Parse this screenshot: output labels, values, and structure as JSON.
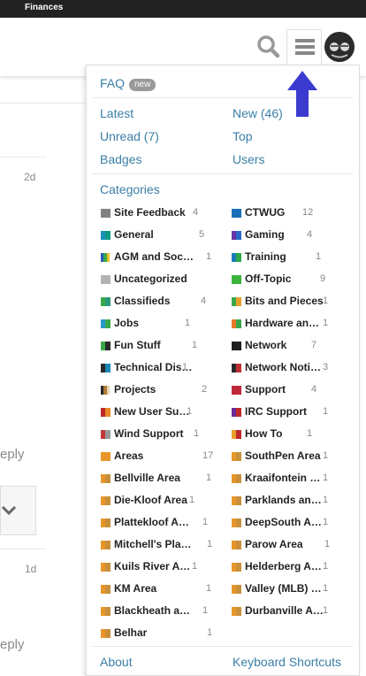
{
  "topbar": {
    "title": "Finances"
  },
  "background": {
    "time_1": "2d",
    "time_2": "1d",
    "reply_1": "eply",
    "reply_2": "eply"
  },
  "header": {
    "search_icon": "search-icon",
    "menu_icon": "hamburger-menu-icon",
    "avatar": "user-avatar"
  },
  "menu": {
    "faq": {
      "label": "FAQ",
      "badge": "new"
    },
    "links": [
      {
        "label": "Latest"
      },
      {
        "label": "New (46)"
      },
      {
        "label": "Unread (7)"
      },
      {
        "label": "Top"
      },
      {
        "label": "Badges"
      },
      {
        "label": "Users"
      }
    ],
    "categories_heading": "Categories",
    "categories": [
      {
        "name": "Site Feedback",
        "count": "4",
        "colors": [
          "#808080"
        ]
      },
      {
        "name": "CTWUG",
        "count": "12",
        "colors": [
          "#1a6fb8"
        ]
      },
      {
        "name": "General",
        "count": "5",
        "colors": [
          "#1a8fb8",
          "#0f9a84"
        ]
      },
      {
        "name": "Gaming",
        "count": "4",
        "colors": [
          "#6a34a8",
          "#2a6ac8"
        ]
      },
      {
        "name": "AGM and Soc…",
        "count": "1",
        "colors": [
          "#2a5ab8",
          "#3aa84a",
          "#e8c02a"
        ]
      },
      {
        "name": "Training",
        "count": "1",
        "colors": [
          "#1a7ab8",
          "#2aa84a"
        ]
      },
      {
        "name": "Uncategorized",
        "count": "",
        "colors": [
          "#b3b3b3"
        ]
      },
      {
        "name": "Off-Topic",
        "count": "9",
        "colors": [
          "#3cb43c"
        ]
      },
      {
        "name": "Classifieds",
        "count": "4",
        "colors": [
          "#3aa84a",
          "#2a9a7a"
        ]
      },
      {
        "name": "Bits and Pieces",
        "count": "1",
        "colors": [
          "#3aa84a",
          "#e8a02a"
        ]
      },
      {
        "name": "Jobs",
        "count": "1",
        "colors": [
          "#2a9ac8",
          "#3aa84a"
        ]
      },
      {
        "name": "Hardware an…",
        "count": "1",
        "colors": [
          "#e87a2a",
          "#3aa84a"
        ]
      },
      {
        "name": "Fun Stuff",
        "count": "1",
        "colors": [
          "#3aa84a",
          "#2a2a2a"
        ]
      },
      {
        "name": "Network",
        "count": "7",
        "colors": [
          "#1e1e1e"
        ]
      },
      {
        "name": "Technical Dis…",
        "count": "1",
        "colors": [
          "#2a2a2a",
          "#1a8ab8"
        ]
      },
      {
        "name": "Network Noti…",
        "count": "3",
        "colors": [
          "#2a2a2a",
          "#c03030"
        ]
      },
      {
        "name": "Projects",
        "count": "2",
        "colors": [
          "#2a2a2a",
          "#b07a3a",
          "#e8d8b8"
        ]
      },
      {
        "name": "Support",
        "count": "4",
        "colors": [
          "#c0283a"
        ]
      },
      {
        "name": "New User Su…",
        "count": "1",
        "colors": [
          "#c02828",
          "#e88a2a"
        ]
      },
      {
        "name": "IRC Support",
        "count": "1",
        "colors": [
          "#6a2a9a",
          "#c02828"
        ]
      },
      {
        "name": "Wind Support",
        "count": "1",
        "colors": [
          "#c03a3a",
          "#999999"
        ]
      },
      {
        "name": "How To",
        "count": "1",
        "colors": [
          "#e8a02a",
          "#c02828"
        ]
      },
      {
        "name": "Areas",
        "count": "17",
        "colors": [
          "#e8962a"
        ]
      },
      {
        "name": "SouthPen Area",
        "count": "1",
        "colors": [
          "#e8962a",
          "#c8903a"
        ]
      },
      {
        "name": "Bellville Area",
        "count": "1",
        "colors": [
          "#e8962a",
          "#c8903a"
        ]
      },
      {
        "name": "Kraaifontein …",
        "count": "1",
        "colors": [
          "#e8962a",
          "#c8903a"
        ]
      },
      {
        "name": "Die-Kloof Area",
        "count": "1",
        "colors": [
          "#e8962a",
          "#c8903a"
        ]
      },
      {
        "name": "Parklands an…",
        "count": "1",
        "colors": [
          "#e8962a",
          "#c8903a"
        ]
      },
      {
        "name": "Plattekloof A…",
        "count": "1",
        "colors": [
          "#e8962a",
          "#c8903a"
        ]
      },
      {
        "name": "DeepSouth A…",
        "count": "1",
        "colors": [
          "#e8962a",
          "#c8903a"
        ]
      },
      {
        "name": "Mitchell's Pla…",
        "count": "1",
        "colors": [
          "#e8962a",
          "#c8903a"
        ]
      },
      {
        "name": "Parow Area",
        "count": "1",
        "colors": [
          "#e8962a",
          "#c8903a"
        ]
      },
      {
        "name": "Kuils River A…",
        "count": "1",
        "colors": [
          "#e8962a",
          "#c8903a"
        ]
      },
      {
        "name": "Helderberg A…",
        "count": "1",
        "colors": [
          "#e8962a",
          "#c8903a"
        ]
      },
      {
        "name": "KM Area",
        "count": "1",
        "colors": [
          "#e8962a",
          "#c8903a"
        ]
      },
      {
        "name": "Valley (MLB) …",
        "count": "1",
        "colors": [
          "#e8962a",
          "#c8903a"
        ]
      },
      {
        "name": "Blackheath a…",
        "count": "1",
        "colors": [
          "#e8962a",
          "#c8903a"
        ]
      },
      {
        "name": "Durbanville A…",
        "count": "1",
        "colors": [
          "#e8962a",
          "#c8903a"
        ]
      },
      {
        "name": "Belhar",
        "count": "1",
        "colors": [
          "#e8962a",
          "#c8903a"
        ]
      }
    ],
    "footer": {
      "about": "About",
      "shortcuts": "Keyboard Shortcuts"
    }
  },
  "colors": {
    "link": "#3a7fa6",
    "arrow": "#3b3bd0"
  }
}
